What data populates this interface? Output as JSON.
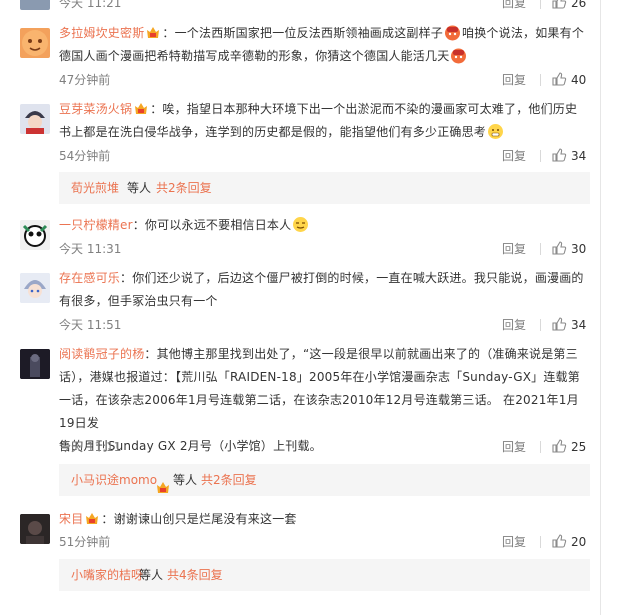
{
  "top_partial": {
    "time": "今天 11:21",
    "reply": "回复",
    "likes": "26"
  },
  "comments": [
    {
      "name": "多拉姆坎史密斯",
      "sep": "：",
      "p1": "一个法西斯国家把一位反法西斯领袖画成这副样子",
      "p2": "咱换个说法，如果有个",
      "l2": "德国人画个漫画把希特勒描写成辛德勒的形象，你猜这个德国人能活几天",
      "time": "47分钟前",
      "reply": "回复",
      "likes": "40"
    },
    {
      "name": "豆芽菜汤火锅",
      "sep": "：",
      "p1": "唉，指望日本那种大环境下出一个出淤泥而不染的漫画家可太难了，他们历史",
      "l2": "书上都是在洗白侵华战争，连学到的历史都是假的，能指望他们有多少正确思考",
      "time": "54分钟前",
      "reply": "回复",
      "likes": "34"
    },
    {
      "name": "一只柠檬精er",
      "sep": "：",
      "p1": "你可以永远不要相信日本人",
      "time": "今天 11:31",
      "reply": "回复",
      "likes": "30"
    },
    {
      "name": "存在感可乐",
      "sep": "：",
      "p1": "你们还少说了，后边这个僵尸被打倒的时候，一直在喊大跃进。我只能说，画漫画的",
      "l2": "有很多，但手冢治虫只有一个",
      "time": "今天 11:51",
      "reply": "回复",
      "likes": "34"
    },
    {
      "name": "阅读鹡冠子的杨",
      "sep": "：",
      "p1": "其他博主那里找到出处了，“这一段是很早以前就画出来了的（准确来说是第三",
      "l2": "话），港媒也报道过：【荒川弘「RAIDEN-18」2005年在小学馆漫画杂志「Sunday-GX」连载第",
      "l3": "一话，在该杂志2006年1月号连载第二话，在该杂志2010年12月号连载第三话。 在2021年1月19日发",
      "l4": "售的月刊Sunday GX 2月号（小学馆）上刊载。",
      "time": "今天 11:11",
      "reply": "回复",
      "likes": "25"
    },
    {
      "name": "宋目",
      "sep": "：",
      "p1": "谢谢谏山创只是烂尾没有来这一套",
      "time": "51分钟前",
      "reply": "回复",
      "likes": "20"
    }
  ],
  "sub_replies": [
    {
      "name": "荀光煎堆",
      "etc": "等人",
      "more": "共2条回复"
    },
    {
      "name": "小马识途momo",
      "etc": "等人",
      "more": "共2条回复"
    },
    {
      "name": "小嘴家的桔呀",
      "etc": "等人",
      "more": "共4条回复"
    }
  ],
  "colors": {
    "link": "#eb7350",
    "meta": "#808080",
    "sub_bg": "#f5f5f5"
  }
}
